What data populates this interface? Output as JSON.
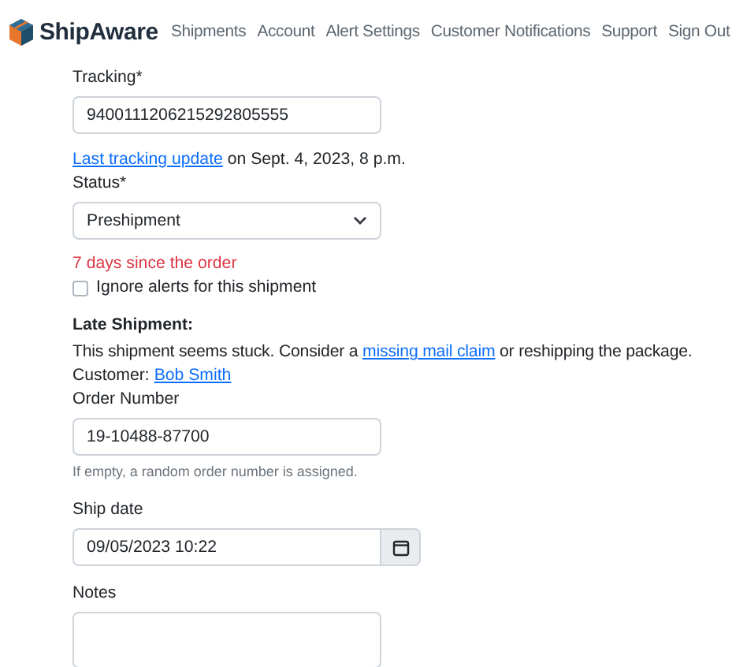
{
  "brand": {
    "name": "ShipAware"
  },
  "nav": [
    {
      "label": "Shipments"
    },
    {
      "label": "Account"
    },
    {
      "label": "Alert Settings"
    },
    {
      "label": "Customer Notifications"
    },
    {
      "label": "Support"
    },
    {
      "label": "Sign Out"
    }
  ],
  "form": {
    "tracking": {
      "label": "Tracking*",
      "value": "9400111206215292805555"
    },
    "last_update": {
      "link": "Last tracking update",
      "text": "on Sept. 4, 2023, 8 p.m."
    },
    "status": {
      "label": "Status*",
      "value": "Preshipment"
    },
    "age_warning": "7 days since the order",
    "ignore_alerts": {
      "label": "Ignore alerts for this shipment",
      "checked": false
    },
    "late_shipment": {
      "heading": "Late Shipment:",
      "message_before": "This shipment seems stuck. Consider a",
      "link": "missing mail claim",
      "message_after": "or reshipping the package."
    },
    "customer": {
      "label": "Customer:",
      "name": "Bob Smith"
    },
    "order_number": {
      "label": "Order Number",
      "value": "19-10488-87700",
      "help": "If empty, a random order number is assigned."
    },
    "ship_date": {
      "label": "Ship date",
      "value": "09/05/2023 10:22"
    },
    "notes": {
      "label": "Notes"
    }
  }
}
